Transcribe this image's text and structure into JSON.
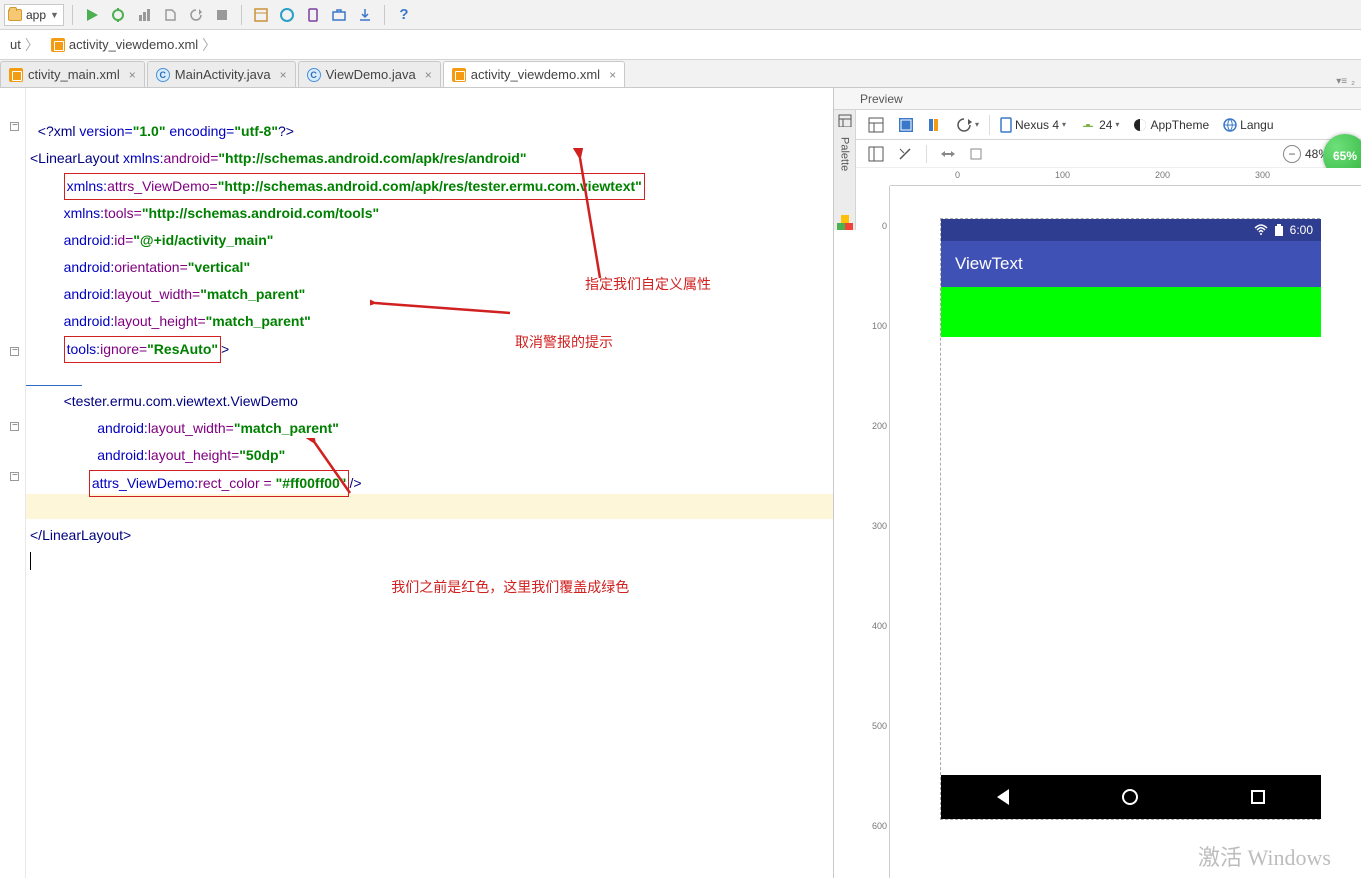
{
  "toolbar": {
    "module_label": "app"
  },
  "breadcrumb": {
    "item1": "ut",
    "item2": "activity_viewdemo.xml"
  },
  "tabs": [
    {
      "label": "ctivity_main.xml",
      "type": "xml",
      "active": false
    },
    {
      "label": "MainActivity.java",
      "type": "java",
      "active": false
    },
    {
      "label": "ViewDemo.java",
      "type": "java",
      "active": false
    },
    {
      "label": "activity_viewdemo.xml",
      "type": "xml",
      "active": true
    }
  ],
  "tabs_right_label": "₂",
  "code_lines": {
    "l1a": "<?xml ",
    "l1b": "version=",
    "l1c": "\"1.0\" ",
    "l1d": "encoding=",
    "l1e": "\"utf-8\"",
    "l1f": "?>",
    "l2a": "<LinearLayout ",
    "l2b": "xmlns:",
    "l2c": "android=",
    "l2d": "\"http://schemas.android.com/apk/res/android\"",
    "l3a": "xmlns:",
    "l3b": "attrs_ViewDemo=",
    "l3c": "\"http://schemas.android.com/apk/res/tester.ermu.com.viewtext\"",
    "l4a": "xmlns:",
    "l4b": "tools=",
    "l4c": "\"http://schemas.android.com/tools\"",
    "l5a": "android:",
    "l5b": "id=",
    "l5c": "\"@+id/activity_main\"",
    "l6a": "android:",
    "l6b": "orientation=",
    "l6c": "\"vertical\"",
    "l7a": "android:",
    "l7b": "layout_width=",
    "l7c": "\"match_parent\"",
    "l8a": "android:",
    "l8b": "layout_height=",
    "l8c": "\"match_parent\"",
    "l9a": "tools:",
    "l9b": "ignore=",
    "l9c": "\"ResAuto\"",
    "l9d": ">",
    "l11a": "<tester.ermu.com.viewtext.ViewDemo",
    "l12a": "android:",
    "l12b": "layout_width=",
    "l12c": "\"match_parent\"",
    "l13a": "android:",
    "l13b": "layout_height=",
    "l13c": "\"50dp\"",
    "l14a": "attrs_ViewDemo:",
    "l14b": "rect_color = ",
    "l14c": "\"#ff00ff00\"",
    "l14d": "/>",
    "l16": "</LinearLayout>"
  },
  "annotations": {
    "a1": "指定我们自定义属性",
    "a2": "取消警报的提示",
    "a3": "我们之前是红色，这里我们覆盖成绿色"
  },
  "preview": {
    "header": "Preview",
    "device": "Nexus 4",
    "api": "24",
    "theme": "AppTheme",
    "lang": "Langu",
    "zoom": "48%",
    "badge": "65%",
    "app_title": "ViewText",
    "clock": "6:00",
    "ruler_h": [
      "0",
      "100",
      "200",
      "300"
    ],
    "ruler_v": [
      "0",
      "100",
      "200",
      "300",
      "400",
      "500",
      "600"
    ]
  },
  "watermark": "激活 Windows",
  "palette_label": "Palette"
}
